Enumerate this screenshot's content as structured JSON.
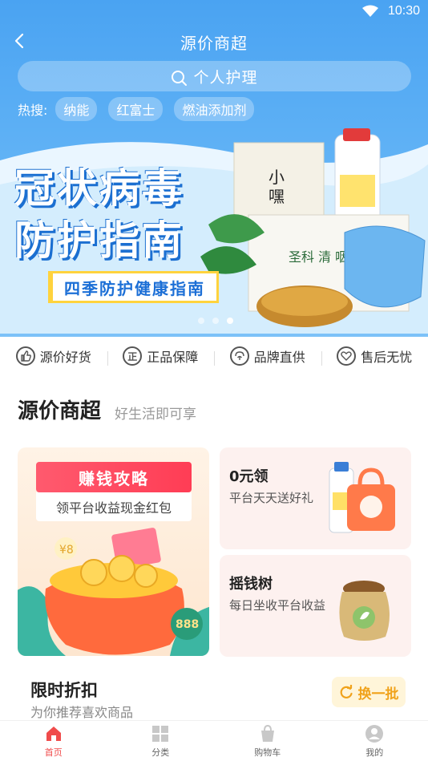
{
  "status": {
    "time": "10:30"
  },
  "header": {
    "title": "源价商超"
  },
  "search": {
    "placeholder": "个人护理"
  },
  "hot": {
    "label": "热搜:",
    "tags": [
      "纳能",
      "红富士",
      "燃油添加剂"
    ]
  },
  "banner": {
    "title_line1": "冠状病毒",
    "title_line2": "防护指南",
    "subtitle": "四季防护健康指南",
    "dot_count": 3,
    "active_dot": 3
  },
  "features": [
    {
      "icon": "thumbs-up-icon",
      "glyph": "👍",
      "label": "源价好货"
    },
    {
      "icon": "genuine-icon",
      "glyph": "正",
      "label": "正品保障"
    },
    {
      "icon": "brand-icon",
      "glyph": "?",
      "label": "品牌直供"
    },
    {
      "icon": "heart-icon",
      "glyph": "♡",
      "label": "售后无忧"
    }
  ],
  "section": {
    "title": "源价商超",
    "subtitle": "好生活即可享"
  },
  "cards": {
    "earn": {
      "badge": "赚钱攻略",
      "desc": "领平台收益现金红包",
      "coin_text": "888"
    },
    "free": {
      "title": "0元领",
      "desc": "平台天天送好礼"
    },
    "tree": {
      "title": "摇钱树",
      "desc": "每日坐收平台收益"
    }
  },
  "deal": {
    "title": "限时折扣",
    "subtitle": "为你推荐喜欢商品",
    "refresh_label": "换一批"
  },
  "tabs": [
    {
      "label": "首页",
      "icon": "home-icon",
      "active": true
    },
    {
      "label": "分类",
      "icon": "category-icon",
      "active": false
    },
    {
      "label": "购物车",
      "icon": "cart-icon",
      "active": false
    },
    {
      "label": "我的",
      "icon": "profile-icon",
      "active": false
    }
  ],
  "colors": {
    "primary_blue": "#4aa3f2",
    "accent_red": "#f04b4b",
    "refresh_orange": "#f0a21a"
  }
}
